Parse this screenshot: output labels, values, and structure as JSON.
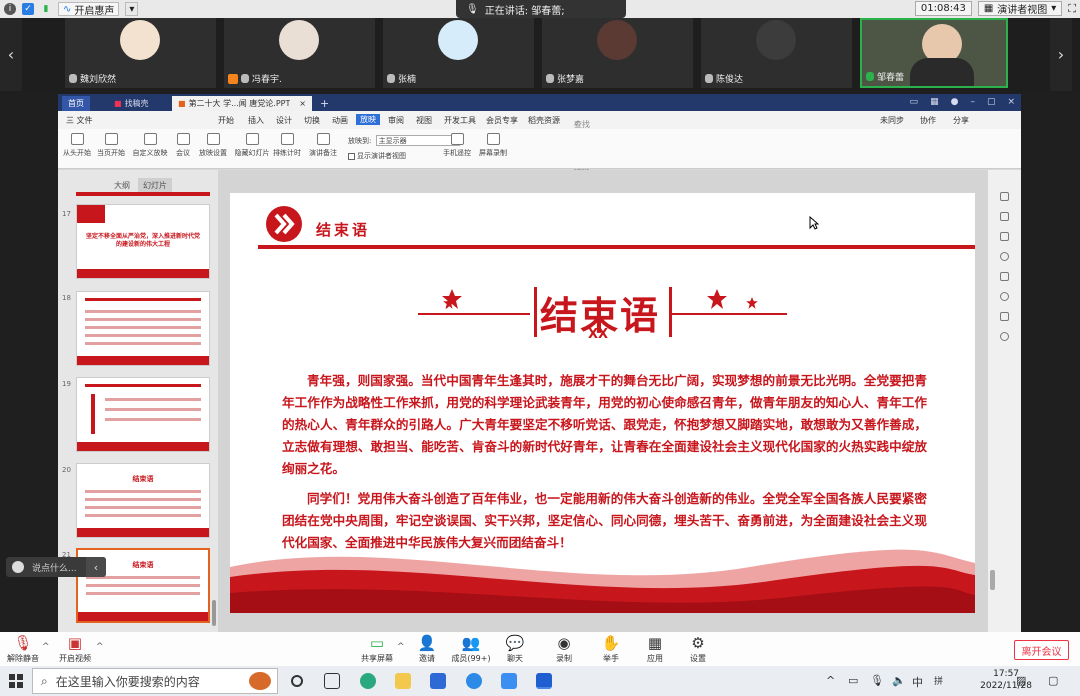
{
  "top_bar": {
    "beauty_label": "开启惠声",
    "speaking_label": "正在讲话: 邹春蕾;",
    "timer": "01:08:43",
    "view_mode": "演讲者视图"
  },
  "participants": [
    {
      "name": "魏刘欣然"
    },
    {
      "name": "冯春宇."
    },
    {
      "name": "张楠"
    },
    {
      "name": "张梦嘉"
    },
    {
      "name": "陈俊达"
    },
    {
      "name": "邹春蕾"
    }
  ],
  "wps": {
    "tabs": [
      "首页",
      "找稿壳",
      "第二十大 学...闻 唐党论.PPT"
    ],
    "menu": [
      "三 文件",
      "开始",
      "插入",
      "设计",
      "切换",
      "动画",
      "放映",
      "审阅",
      "视图",
      "开发工具",
      "会员专享",
      "稻壳资源",
      "查找命令、搜索模板",
      "未同步",
      "协作",
      "分享"
    ],
    "menu_active_index": 6,
    "ribbon": [
      "从头开始",
      "当页开始",
      "自定义放映",
      "会议",
      "放映设置",
      "隐藏幻灯片",
      "排练计时",
      "演讲备注",
      "放映到:",
      "主显示器",
      "显示演讲者视图",
      "手机遥控",
      "屏幕录制"
    ],
    "panel_tabs": [
      "大纲",
      "幻灯片"
    ],
    "thumb_numbers": [
      "17",
      "18",
      "19",
      "20",
      "21"
    ],
    "thumb_texts": [
      "坚定不移全面从严治党，深入推进新时代党的建设新的伟大工程",
      "结束语",
      "结束语"
    ]
  },
  "slide": {
    "header_title": "结束语",
    "big_title": "结束语",
    "big_sub": "XX",
    "paragraph1": "青年强，则国家强。当代中国青年生逢其时，施展才干的舞台无比广阔，实现梦想的前景无比光明。全党要把青年工作作为战略性工作来抓，用党的科学理论武装青年，用党的初心使命感召青年，做青年朋友的知心人、青年工作的热心人、青年群众的引路人。广大青年要坚定不移听党话、跟党走，怀抱梦想又脚踏实地，敢想敢为又善作善成，立志做有理想、敢担当、能吃苦、肯奋斗的新时代好青年，让青春在全面建设社会主义现代化国家的火热实践中绽放绚丽之花。",
    "paragraph2": "同学们！党用伟大奋斗创造了百年伟业，也一定能用新的伟大奋斗创造新的伟业。全党全军全国各族人民要紧密团结在党中央周围，牢记空谈误国、实干兴邦，坚定信心、同心同德，埋头苦干、奋勇前进，为全面建设社会主义现代化国家、全面推进中华民族伟大复兴而团结奋斗！"
  },
  "comment": {
    "placeholder": "说点什么..."
  },
  "controls": {
    "mute": "解除静音",
    "video": "开启视频",
    "share": "共享屏幕",
    "invite": "邀请",
    "members": "成员(99+)",
    "chat": "聊天",
    "record": "录制",
    "raise": "举手",
    "apps": "应用",
    "settings": "设置",
    "leave": "离开会议"
  },
  "taskbar": {
    "search_placeholder": "在这里输入你要搜索的内容",
    "ime_lang": "中",
    "ime_mode": "拼",
    "time": "17:57",
    "date": "2022/11/28"
  },
  "colors": {
    "accent_red": "#c8161d",
    "wps_blue": "#23386b"
  }
}
